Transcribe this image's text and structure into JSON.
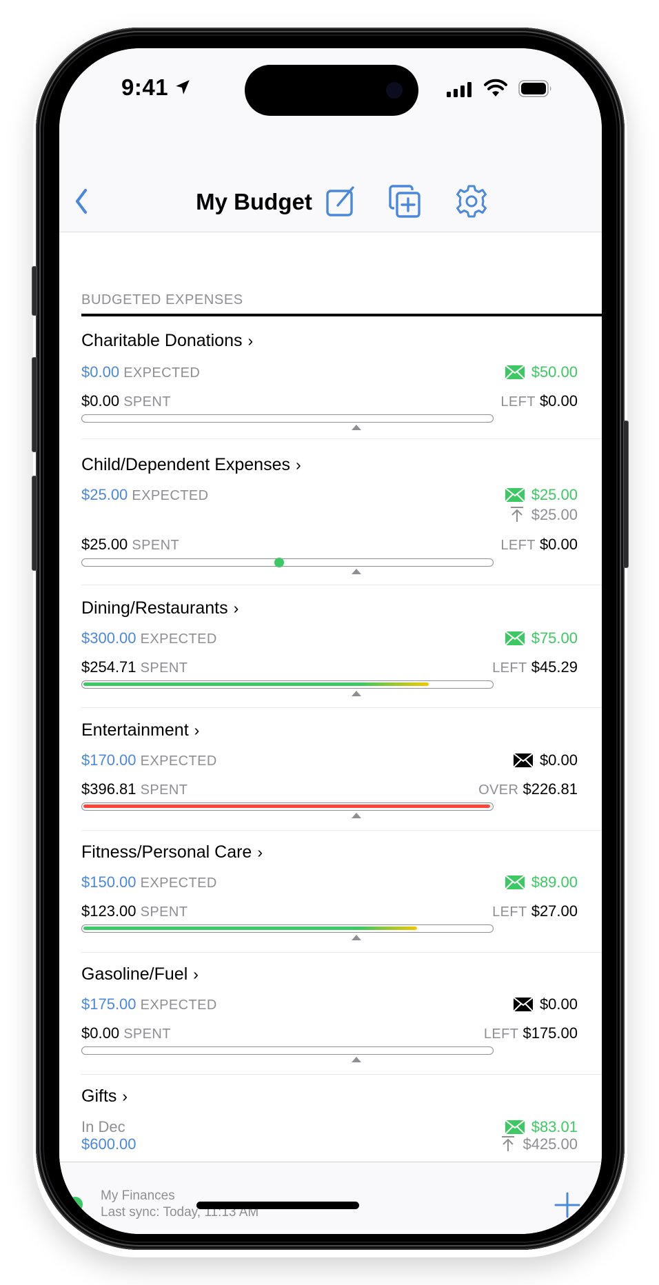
{
  "status_bar": {
    "time": "9:41"
  },
  "nav": {
    "title": "My Budget",
    "back_icon": "chevron-left-icon",
    "compose_icon": "compose-icon",
    "duplicate_icon": "duplicate-add-icon",
    "settings_icon": "gear-icon"
  },
  "section": {
    "label": "BUDGETED EXPENSES"
  },
  "labels": {
    "expected": "EXPECTED",
    "spent": "SPENT",
    "left": "LEFT",
    "over": "OVER"
  },
  "colors": {
    "accent": "#4a88dc",
    "green": "#3cc862",
    "yellow": "#f2c800",
    "red": "#ff453a",
    "gray": "#8e8e93"
  },
  "categories": [
    {
      "name": "Charitable Donations",
      "expected": "$0.00",
      "envelope": "$50.00",
      "envelope_state": "funded",
      "spent": "$0.00",
      "remaining_label": "LEFT",
      "remaining": "$0.00",
      "progress": 0.0,
      "time_marker": 0.667
    },
    {
      "name": "Child/Dependent Expenses",
      "expected": "$25.00",
      "envelope": "$25.00",
      "envelope_state": "funded",
      "rollover": "$25.00",
      "spent": "$25.00",
      "remaining_label": "LEFT",
      "remaining": "$0.00",
      "progress": 0.0,
      "dot_position": 0.48,
      "time_marker": 0.667
    },
    {
      "name": "Dining/Restaurants",
      "expected": "$300.00",
      "envelope": "$75.00",
      "envelope_state": "funded",
      "spent": "$254.71",
      "remaining_label": "LEFT",
      "remaining": "$45.29",
      "progress": 0.849,
      "progress_style": "green-yellow",
      "time_marker": 0.667
    },
    {
      "name": "Entertainment",
      "expected": "$170.00",
      "envelope": "$0.00",
      "envelope_state": "empty",
      "spent": "$396.81",
      "remaining_label": "OVER",
      "remaining": "$226.81",
      "progress": 1.0,
      "progress_style": "red",
      "time_marker": 0.667
    },
    {
      "name": "Fitness/Personal Care",
      "expected": "$150.00",
      "envelope": "$89.00",
      "envelope_state": "funded",
      "spent": "$123.00",
      "remaining_label": "LEFT",
      "remaining": "$27.00",
      "progress": 0.82,
      "progress_style": "green-yellow",
      "time_marker": 0.667
    },
    {
      "name": "Gasoline/Fuel",
      "expected": "$175.00",
      "envelope": "$0.00",
      "envelope_state": "empty",
      "spent": "$0.00",
      "remaining_label": "LEFT",
      "remaining": "$175.00",
      "progress": 0.0,
      "time_marker": 0.667
    },
    {
      "name": "Gifts",
      "schedule": "In Dec",
      "expected": "$600.00",
      "envelope": "$83.01",
      "envelope_state": "funded",
      "rollover": "$425.00"
    }
  ],
  "footer": {
    "account": "My Finances",
    "sync": "Last sync: Today, 11:13 AM",
    "add_icon": "plus-icon"
  }
}
